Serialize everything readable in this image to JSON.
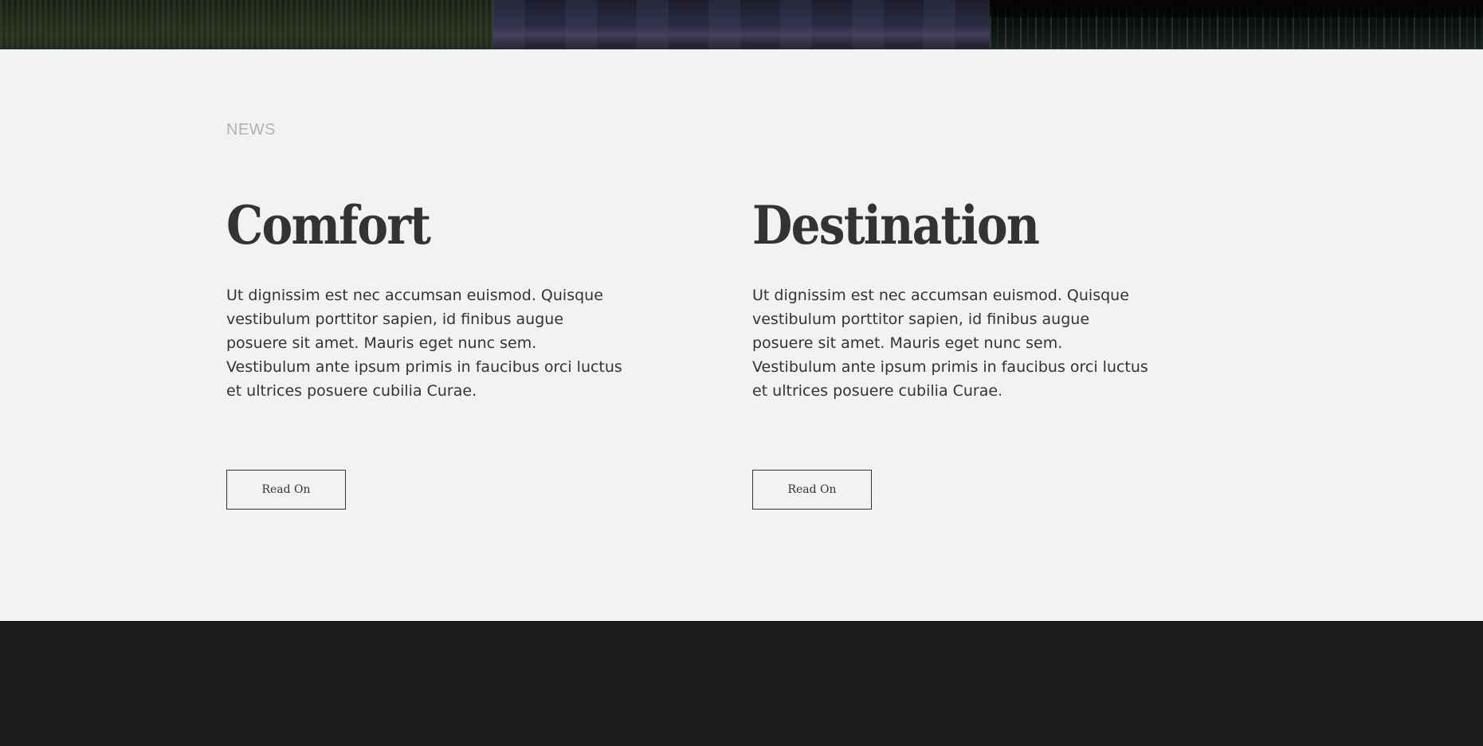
{
  "section": {
    "label": "NEWS"
  },
  "articles": [
    {
      "title": "Comfort",
      "body": "Ut dignissim est nec accumsan euismod. Quisque vestibulum porttitor sapien, id finibus augue posuere sit amet. Mauris eget nunc sem. Vestibulum ante ipsum primis in faucibus orci luctus et ultrices posuere cubilia Curae.",
      "button_label": "Read On"
    },
    {
      "title": "Destination",
      "body": "Ut dignissim est nec accumsan euismod. Quisque vestibulum porttitor sapien, id finibus augue posuere sit amet. Mauris eget nunc sem. Vestibulum ante ipsum primis in faucibus orci luctus et ultrices posuere cubilia Curae.",
      "button_label": "Read On"
    }
  ],
  "colors": {
    "background": "#f2f2f2",
    "text": "#333333",
    "label": "#b3b3b3",
    "footer": "#1c1c1c"
  }
}
